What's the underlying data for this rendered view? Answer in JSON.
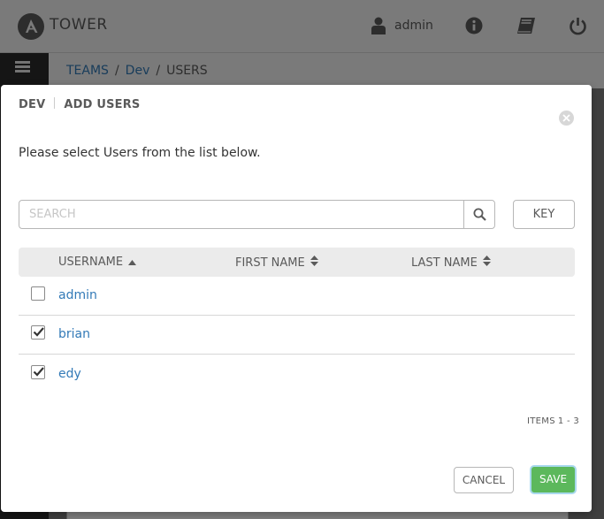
{
  "topbar": {
    "brand": "TOWER",
    "user": "admin",
    "icons": [
      "user-icon",
      "info-icon",
      "book-icon",
      "power-icon"
    ]
  },
  "breadcrumb": {
    "items": [
      "TEAMS",
      "Dev",
      "USERS"
    ],
    "separator": "/"
  },
  "modal": {
    "title_team": "DEV",
    "title_action": "ADD USERS",
    "instructions": "Please select Users from the list below.",
    "search": {
      "placeholder": "SEARCH",
      "value": ""
    },
    "key_label": "KEY",
    "columns": [
      {
        "label": "USERNAME",
        "sort": "ascending"
      },
      {
        "label": "FIRST NAME",
        "sort": "unsorted"
      },
      {
        "label": "LAST NAME",
        "sort": "unsorted"
      }
    ],
    "rows": [
      {
        "username": "admin",
        "first_name": "",
        "last_name": "",
        "checked": false
      },
      {
        "username": "brian",
        "first_name": "",
        "last_name": "",
        "checked": true
      },
      {
        "username": "edy",
        "first_name": "",
        "last_name": "",
        "checked": true
      }
    ],
    "items_label": "ITEMS",
    "items_range": "1 - 3",
    "cancel_label": "CANCEL",
    "save_label": "SAVE"
  },
  "colors": {
    "link": "#337ab7",
    "save": "#5cb85c",
    "sidenav": "#2b2b2b"
  }
}
